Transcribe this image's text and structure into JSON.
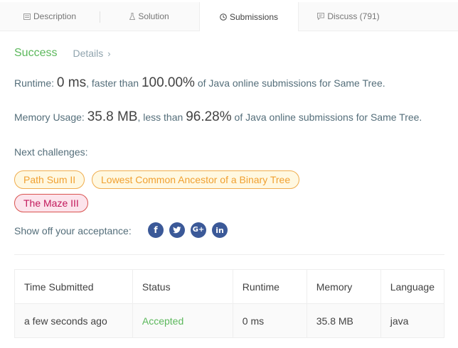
{
  "tabs": [
    {
      "label": "Description"
    },
    {
      "label": "Solution"
    },
    {
      "label": "Submissions"
    },
    {
      "label": "Discuss (791)"
    }
  ],
  "result": {
    "status": "Success",
    "details_label": "Details",
    "chevron": "›"
  },
  "runtime": {
    "label": "Runtime:",
    "value": "0 ms",
    "compare": ", faster than",
    "percent": "100.00%",
    "suffix": "of Java online submissions for Same Tree."
  },
  "memory": {
    "label": "Memory Usage:",
    "value": "35.8 MB",
    "compare": ", less than",
    "percent": "96.28%",
    "suffix": "of Java online submissions for Same Tree."
  },
  "next_challenges": {
    "label": "Next challenges:",
    "items": [
      {
        "title": "Path Sum II",
        "difficulty_color": "#f0ad4e"
      },
      {
        "title": "Lowest Common Ancestor of a Binary Tree",
        "difficulty_color": "#f0ad4e"
      },
      {
        "title": "The Maze III",
        "difficulty_color": "#d9534f"
      }
    ]
  },
  "share": {
    "label": "Show off your acceptance:",
    "icons": [
      "facebook-icon",
      "twitter-icon",
      "google-plus-icon",
      "linkedin-icon"
    ]
  },
  "table": {
    "headers": [
      "Time Submitted",
      "Status",
      "Runtime",
      "Memory",
      "Language"
    ],
    "rows": [
      {
        "time": "a few seconds ago",
        "status": "Accepted",
        "runtime": "0 ms",
        "memory": "35.8 MB",
        "language": "java"
      }
    ]
  },
  "colors": {
    "success": "#5cb85c",
    "medium": "#f0ad4e",
    "hard": "#d9534f",
    "social": "#3b5998"
  }
}
